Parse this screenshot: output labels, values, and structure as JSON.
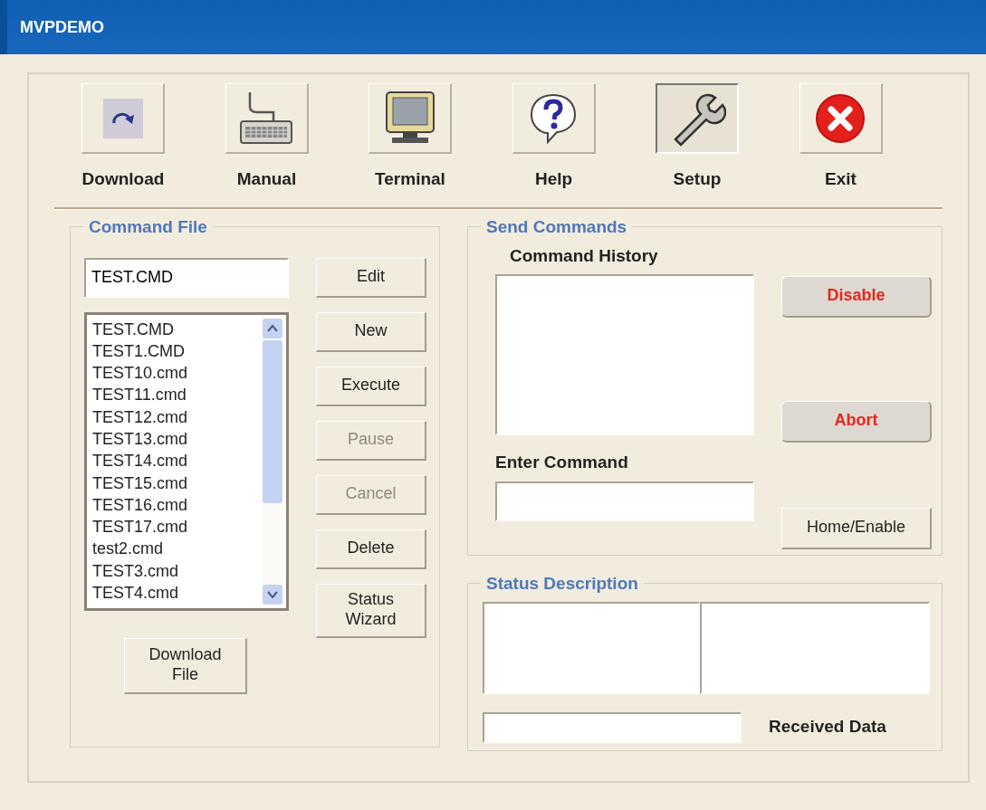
{
  "window": {
    "title": "MVPDEMO"
  },
  "toolbar": [
    {
      "label": "Download",
      "kind": "download",
      "pressed": false
    },
    {
      "label": "Manual",
      "kind": "keyboard",
      "pressed": false
    },
    {
      "label": "Terminal",
      "kind": "monitor",
      "pressed": false
    },
    {
      "label": "Help",
      "kind": "help",
      "pressed": false
    },
    {
      "label": "Setup",
      "kind": "wrench",
      "pressed": true
    },
    {
      "label": "Exit",
      "kind": "exit",
      "pressed": false
    }
  ],
  "command_file": {
    "title": "Command File",
    "file_name": "TEST.CMD",
    "files": [
      "TEST.CMD",
      "TEST1.CMD",
      "TEST10.cmd",
      "TEST11.cmd",
      "TEST12.cmd",
      "TEST13.cmd",
      "TEST14.cmd",
      "TEST15.cmd",
      "TEST16.cmd",
      "TEST17.cmd",
      "test2.cmd",
      "TEST3.cmd",
      "TEST4.cmd"
    ],
    "buttons": [
      {
        "label": "Edit",
        "disabled": false
      },
      {
        "label": "New",
        "disabled": false
      },
      {
        "label": "Execute",
        "disabled": false
      },
      {
        "label": "Pause",
        "disabled": true
      },
      {
        "label": "Cancel",
        "disabled": true
      },
      {
        "label": "Delete",
        "disabled": false
      },
      {
        "label": "Status Wizard",
        "disabled": false
      }
    ],
    "download_button": "Download File"
  },
  "send_commands": {
    "title": "Send Commands",
    "history_label": "Command History",
    "enter_label": "Enter Command",
    "buttons": [
      {
        "label": "Disable",
        "kind": "alert"
      },
      {
        "label": "Abort",
        "kind": "alert"
      },
      {
        "label": "Home/Enable",
        "kind": "normal"
      }
    ]
  },
  "status_description": {
    "title": "Status Description",
    "received_label": "Received Data"
  }
}
